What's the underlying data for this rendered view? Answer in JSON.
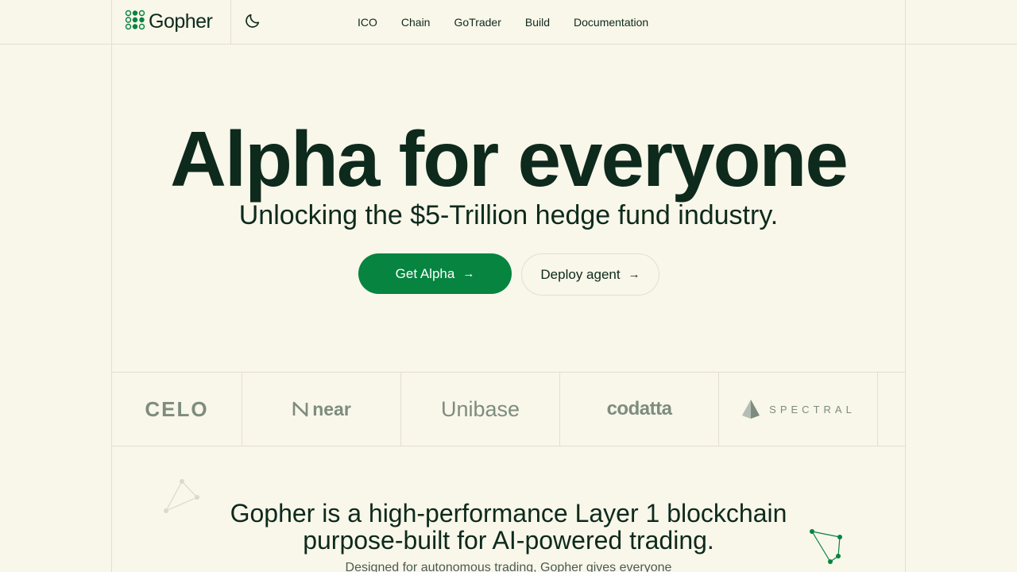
{
  "header": {
    "logo_text": "Gopher",
    "nav": [
      {
        "label": "ICO"
      },
      {
        "label": "Chain"
      },
      {
        "label": "GoTrader"
      },
      {
        "label": "Build"
      },
      {
        "label": "Documentation"
      }
    ]
  },
  "hero": {
    "title": "Alpha for everyone",
    "subtitle": "Unlocking the $5-Trillion hedge fund industry.",
    "primary_button": "Get Alpha",
    "secondary_button": "Deploy agent",
    "arrow": "→"
  },
  "partners": [
    {
      "name": "celo",
      "display": "CELO"
    },
    {
      "name": "near",
      "display": "near"
    },
    {
      "name": "Unibase",
      "display": "Unibase"
    },
    {
      "name": "codatta",
      "display": "codatta"
    },
    {
      "name": "SPECTRAL",
      "display": "SPECTRAL"
    }
  ],
  "section2": {
    "title_line1": "Gopher is a high-performance Layer 1 blockchain",
    "title_line2": "purpose-built for AI-powered trading.",
    "subtitle": "Designed for autonomous trading, Gopher gives everyone"
  },
  "colors": {
    "background": "#f9f6ea",
    "primary": "#068440",
    "text": "#0d2a1c",
    "muted": "#7d8c7e",
    "border": "#e3dfd2"
  },
  "icons": {
    "logo": "gopher-dots-logo-icon",
    "theme": "moon-icon",
    "arrow": "arrow-right-icon"
  }
}
